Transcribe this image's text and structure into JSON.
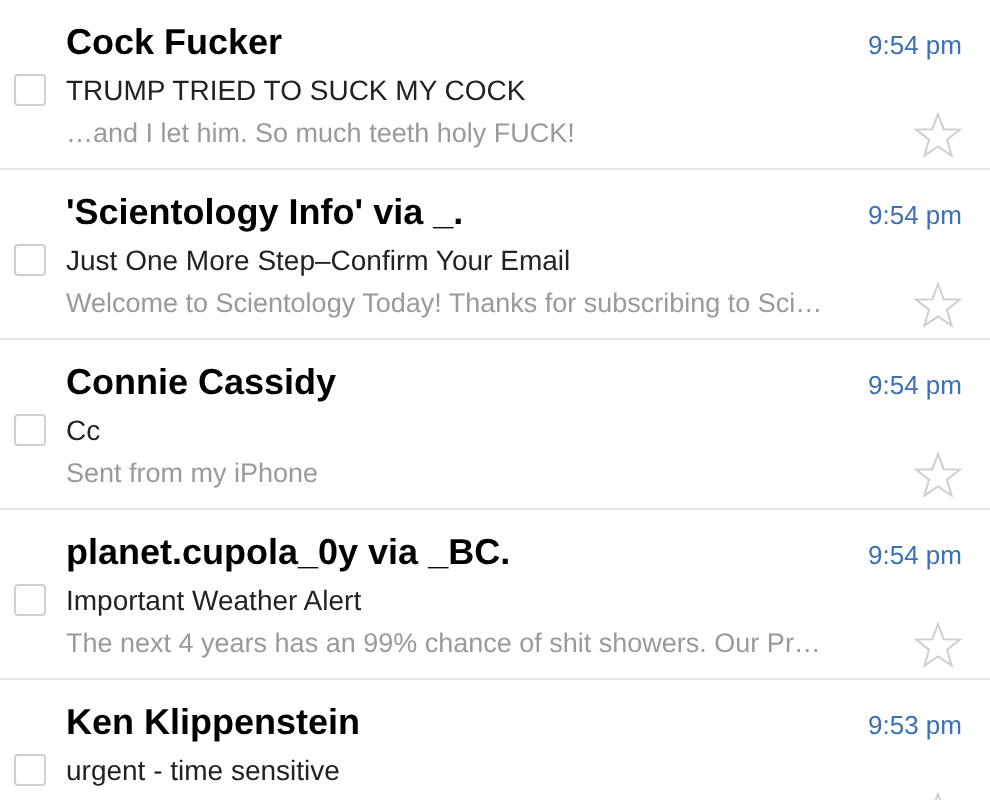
{
  "messages": [
    {
      "sender": "Cock Fucker",
      "time": "9:54 pm",
      "subject": "TRUMP TRIED TO SUCK MY COCK",
      "preview": "…and I let him. So much teeth holy FUCK!",
      "checked": false,
      "starred": false
    },
    {
      "sender": "'Scientology Info' via _.",
      "time": "9:54 pm",
      "subject": "Just One More Step–Confirm Your Email",
      "preview": "Welcome to Scientology Today! Thanks for subscribing to Sci…",
      "checked": false,
      "starred": false
    },
    {
      "sender": "Connie Cassidy",
      "time": "9:54 pm",
      "subject": "Cc",
      "preview": "Sent from my iPhone",
      "checked": false,
      "starred": false
    },
    {
      "sender": "planet.cupola_0y via _BC.",
      "time": "9:54 pm",
      "subject": "Important Weather Alert",
      "preview": "The next 4 years has an 99% chance of shit showers. Our Pr…",
      "checked": false,
      "starred": false
    },
    {
      "sender": "Ken Klippenstein",
      "time": "9:53 pm",
      "subject": "urgent - time sensitive",
      "checked": false,
      "starred": false
    }
  ]
}
